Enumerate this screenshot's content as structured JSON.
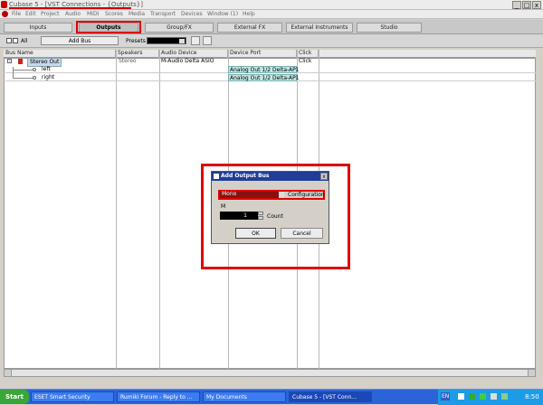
{
  "window": {
    "title": "Cubase 5 - [VST Connections - {Outputs}]",
    "min": "_",
    "max": "□",
    "close": "x"
  },
  "menu": [
    "File",
    "Edit",
    "Project",
    "Audio",
    "MIDI",
    "Scores",
    "Media",
    "Transport",
    "Devices",
    "Window (1)",
    "Help"
  ],
  "tabs": [
    {
      "label": "Inputs"
    },
    {
      "label": "Outputs"
    },
    {
      "label": "Group/FX"
    },
    {
      "label": "External FX"
    },
    {
      "label": "External Instruments"
    },
    {
      "label": "Studio"
    }
  ],
  "toolbar": {
    "all_label": "All",
    "add_bus": "Add Bus",
    "presets_label": "Presets"
  },
  "columns": [
    "Bus Name",
    "Speakers",
    "Audio Device",
    "Device Port",
    "Click"
  ],
  "rows": [
    {
      "name": "Stereo Out",
      "speakers": "Stereo",
      "device": "M-Audio Delta ASIO",
      "port": "",
      "click": "Click"
    },
    {
      "name": "left",
      "speakers": "",
      "device": "",
      "port": "Analog Out 1/2 Delta-AP1",
      "click": ""
    },
    {
      "name": "right",
      "speakers": "",
      "device": "",
      "port": "Analog Out 1/2 Delta-AP1",
      "click": ""
    }
  ],
  "dialog": {
    "title": "Add Output Bus",
    "configuration_value": "Mono",
    "configuration_label": "Configuration",
    "m_label": "M",
    "count_value": "1",
    "count_label": "Count",
    "ok": "OK",
    "cancel": "Cancel"
  },
  "taskbar": {
    "start": "Start",
    "items": [
      {
        "label": "ESET Smart Security"
      },
      {
        "label": "Rumiki Forum - Reply to ..."
      },
      {
        "label": "My Documents"
      },
      {
        "label": "Cubase 5 - [VST Conn..."
      }
    ],
    "lang": "EN",
    "clock": "8:50"
  },
  "colors": {
    "highlight_red": "#e00000",
    "dialog_title": "#1f3d99",
    "port_green": "#bfe9e6"
  }
}
